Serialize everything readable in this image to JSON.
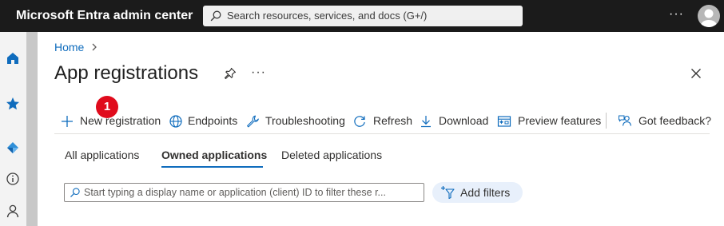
{
  "topbar": {
    "brand": "Microsoft Entra admin center",
    "search_placeholder": "Search resources, services, and docs (G+/)",
    "more_label": "···"
  },
  "rail": {
    "icons": [
      "home-icon",
      "star-icon",
      "entra-diamond-icon",
      "info-icon",
      "person-icon"
    ]
  },
  "breadcrumb": {
    "home": "Home"
  },
  "page": {
    "title": "App registrations",
    "more_label": "···"
  },
  "toolbar": {
    "new_registration": "New registration",
    "endpoints": "Endpoints",
    "troubleshooting": "Troubleshooting",
    "refresh": "Refresh",
    "download": "Download",
    "preview_features": "Preview features",
    "feedback": "Got feedback?"
  },
  "annotation": {
    "step": "1"
  },
  "tabs": {
    "all": "All applications",
    "owned": "Owned applications",
    "deleted": "Deleted applications",
    "active": "owned"
  },
  "filter": {
    "placeholder": "Start typing a display name or application (client) ID to filter these r...",
    "add_filters": "Add filters"
  },
  "colors": {
    "topbar": "#1b1b1b",
    "accent": "#0f6cbd",
    "badge": "#e00b1c",
    "pill": "#e8f0fb"
  }
}
